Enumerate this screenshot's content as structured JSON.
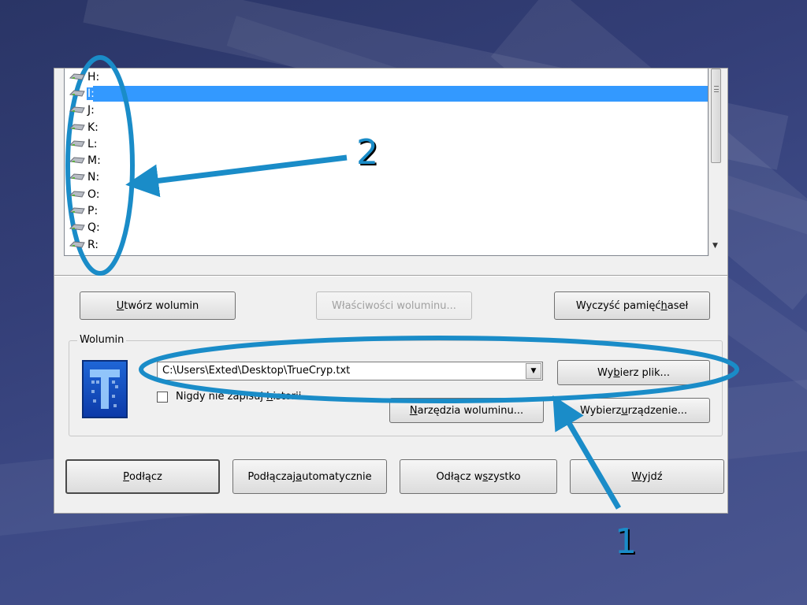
{
  "drives": [
    {
      "letter": "H:",
      "selected": false
    },
    {
      "letter": "I:",
      "selected": true
    },
    {
      "letter": "J:",
      "selected": false
    },
    {
      "letter": "K:",
      "selected": false
    },
    {
      "letter": "L:",
      "selected": false
    },
    {
      "letter": "M:",
      "selected": false
    },
    {
      "letter": "N:",
      "selected": false
    },
    {
      "letter": "O:",
      "selected": false
    },
    {
      "letter": "P:",
      "selected": false
    },
    {
      "letter": "Q:",
      "selected": false
    },
    {
      "letter": "R:",
      "selected": false
    }
  ],
  "toolbar": {
    "create_volume": {
      "prefix": "",
      "ul": "U",
      "rest": "twórz wolumin"
    },
    "volume_properties": "Właściwości woluminu...",
    "wipe_cache": {
      "prefix": "Wyczyść pamięć ",
      "ul": "h",
      "rest": "aseł"
    }
  },
  "volume_group": {
    "label": "Wolumin",
    "path_value": "C:\\Users\\Exted\\Desktop\\TrueCryp.txt",
    "never_save_history": {
      "prefix": "Nigdy nie zapisuj ",
      "ul": "h",
      "rest": "istorii"
    },
    "select_file": {
      "prefix": "Wy",
      "ul": "b",
      "rest": "ierz plik..."
    },
    "volume_tools": {
      "prefix": "",
      "ul": "N",
      "rest": "arzędzia woluminu..."
    },
    "select_device": {
      "prefix": "Wybierz ",
      "ul": "u",
      "rest": "rządzenie..."
    }
  },
  "actions": {
    "mount": {
      "prefix": "",
      "ul": "P",
      "rest": "odłącz"
    },
    "auto_mount": {
      "prefix": "Podłączaj ",
      "ul": "a",
      "rest": "utomatycznie"
    },
    "dismount_all": {
      "prefix": "Odłącz w",
      "ul": "s",
      "rest": "zystko"
    },
    "exit": {
      "prefix": "",
      "ul": "W",
      "rest": "yjdź"
    }
  },
  "annotations": {
    "callout_1": "1",
    "callout_2": "2"
  },
  "colors": {
    "selection": "#3399ff",
    "annotation": "#1a8cc8"
  }
}
